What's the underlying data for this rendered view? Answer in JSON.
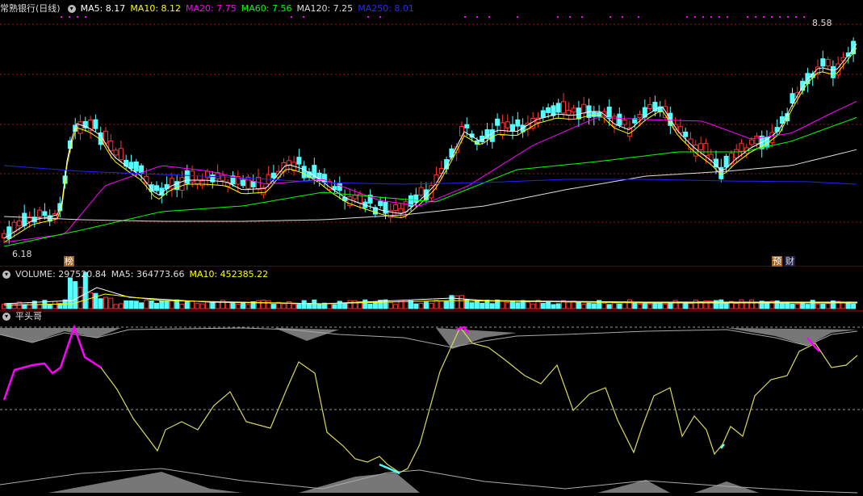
{
  "main": {
    "title": "常熟银行(日线)",
    "ma5_label": "MA5: 8.17",
    "ma10_label": "MA10: 8.12",
    "ma20_label": "MA20: 7.75",
    "ma60_label": "MA60: 7.56",
    "ma120_label": "MA120: 7.25",
    "ma250_label": "MA250: 8.01",
    "high_label": "8.58",
    "low_label": "6.18",
    "badge_bang": "榜",
    "badge_yu": "预",
    "badge_cai": "财"
  },
  "volume": {
    "volume_label": "VOLUME: 297520.84",
    "ma5_label": "MA5: 364773.66",
    "ma10_label": "MA10: 452385.22"
  },
  "indicator": {
    "name": "平头哥"
  },
  "colors": {
    "up": "#ff3232",
    "down": "#54ffff",
    "ma5": "#ffffff",
    "ma10": "#ffff00",
    "ma20": "#ff00ff",
    "ma60": "#00ff00",
    "ma120": "#dddddd",
    "ma250": "#2222ff",
    "grid": "#a01010",
    "magenta": "#ff00ff",
    "olive": "#d8d860"
  },
  "icons": [
    "chevron-down-icon"
  ]
}
